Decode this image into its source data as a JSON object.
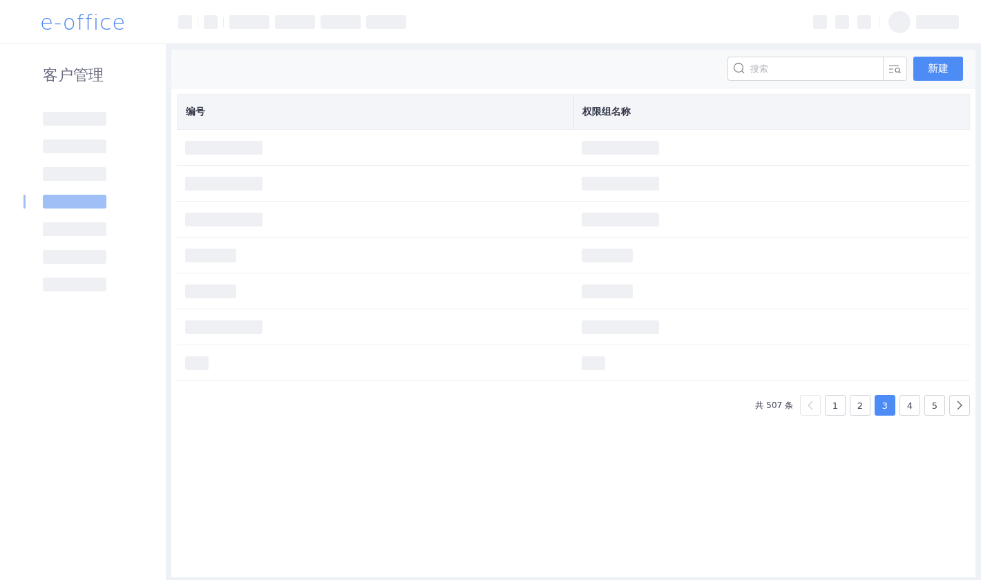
{
  "header": {
    "logo": "e-office"
  },
  "sidebar": {
    "title": "客户管理",
    "items": [
      {
        "selected": false
      },
      {
        "selected": false
      },
      {
        "selected": false
      },
      {
        "selected": true
      },
      {
        "selected": false
      },
      {
        "selected": false
      },
      {
        "selected": false
      }
    ]
  },
  "toolbar": {
    "search": {
      "placeholder": "搜索"
    },
    "new_button": "新建"
  },
  "table": {
    "columns": [
      "编号",
      "权限组名称"
    ],
    "rows": [
      {
        "cells": [
          {
            "kind": "long"
          },
          {
            "kind": "long"
          }
        ]
      },
      {
        "cells": [
          {
            "kind": "long"
          },
          {
            "kind": "long"
          }
        ]
      },
      {
        "cells": [
          {
            "kind": "long"
          },
          {
            "kind": "long"
          }
        ]
      },
      {
        "cells": [
          {
            "kind": "medium"
          },
          {
            "kind": "medium"
          }
        ]
      },
      {
        "cells": [
          {
            "kind": "medium"
          },
          {
            "kind": "medium"
          }
        ]
      },
      {
        "cells": [
          {
            "kind": "long"
          },
          {
            "kind": "long"
          }
        ]
      },
      {
        "cells": [
          {
            "kind": "short"
          },
          {
            "kind": "short"
          }
        ]
      }
    ]
  },
  "pagination": {
    "total": "共 507 条",
    "prev_disabled": true,
    "pages": [
      {
        "label": "1",
        "selected": false
      },
      {
        "label": "2",
        "selected": false
      },
      {
        "label": "3",
        "selected": true
      },
      {
        "label": "4",
        "selected": false
      },
      {
        "label": "5",
        "selected": false
      }
    ]
  }
}
